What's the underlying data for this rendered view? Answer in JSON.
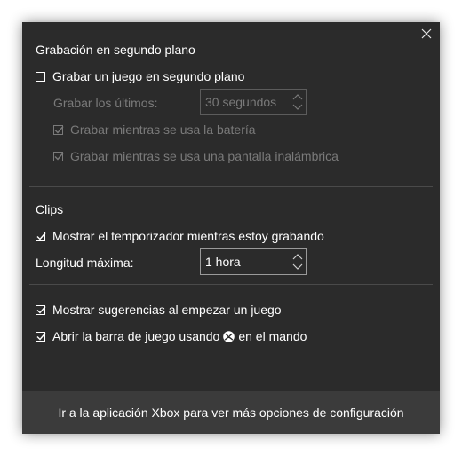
{
  "background_recording": {
    "title": "Grabación en segundo plano",
    "record_in_background": {
      "label": "Grabar un juego en segundo plano",
      "checked": false
    },
    "record_last": {
      "label": "Grabar los últimos:",
      "value": "30 segundos"
    },
    "record_on_battery": {
      "label": "Grabar mientras se usa la batería",
      "checked": true
    },
    "record_wireless_display": {
      "label": "Grabar mientras se usa una pantalla inalámbrica",
      "checked": true
    }
  },
  "clips": {
    "title": "Clips",
    "show_timer": {
      "label": "Mostrar el temporizador mientras estoy grabando",
      "checked": true
    },
    "max_length": {
      "label": "Longitud máxima:",
      "value": "1 hora"
    }
  },
  "other": {
    "show_tips": {
      "label": "Mostrar sugerencias al empezar un juego",
      "checked": true
    },
    "open_with_controller": {
      "label_before": "Abrir la barra de juego usando",
      "label_after": "en el mando",
      "checked": true,
      "icon": "xbox-logo-icon"
    }
  },
  "footer": {
    "label": "Ir a la aplicación Xbox para ver más opciones de configuración"
  },
  "icons": {
    "close": "close-icon",
    "checkmark": "checkmark-icon",
    "spinner": "chevron-up-down-icon"
  }
}
